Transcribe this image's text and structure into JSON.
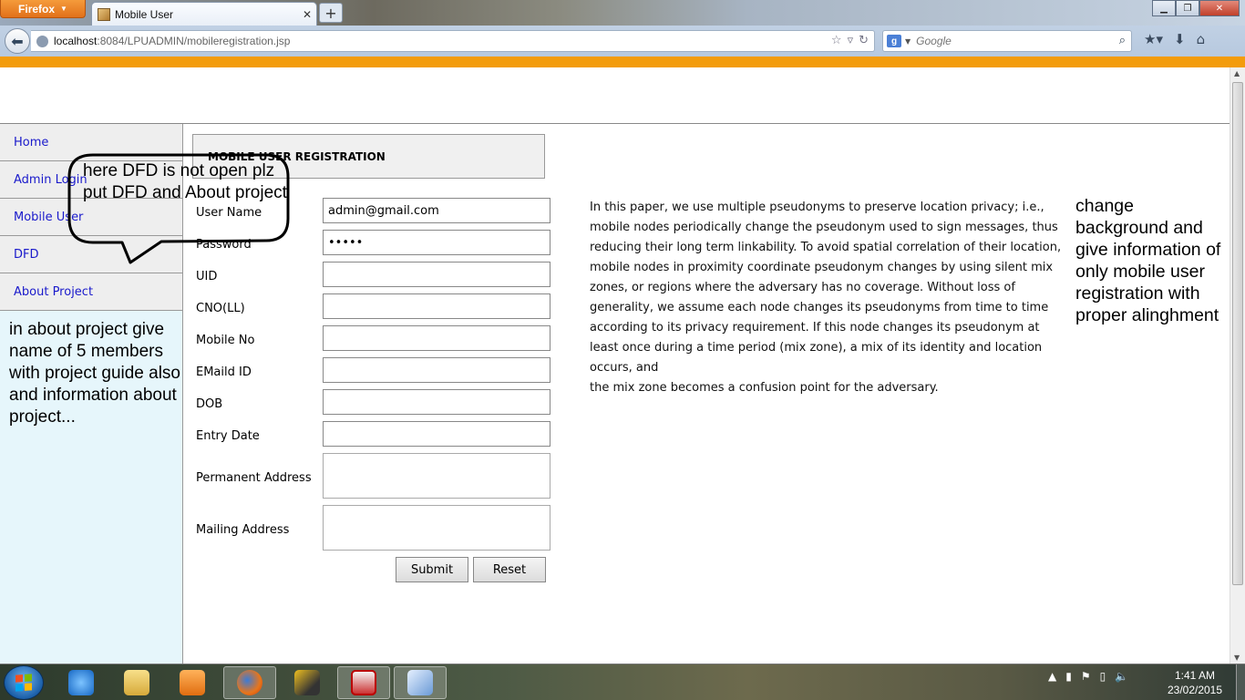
{
  "browser": {
    "menu_button": "Firefox",
    "tab_title": "Mobile User",
    "url_host": "localhost",
    "url_path": ":8084/LPUADMIN/mobileregistration.jsp",
    "search_placeholder": "Google",
    "search_engine_letter": "g"
  },
  "sidebar": {
    "items": [
      {
        "label": "Home"
      },
      {
        "label": "Admin Login"
      },
      {
        "label": "Mobile User"
      },
      {
        "label": "DFD"
      },
      {
        "label": "About Project"
      }
    ],
    "note": "in about project give name of 5 members with project guide also and information about project..."
  },
  "form": {
    "title": "MOBILE USER REGISTRATION",
    "fields": [
      {
        "label": "User Name",
        "value": "admin@gmail.com"
      },
      {
        "label": "Password",
        "value": "12345"
      },
      {
        "label": "UID",
        "value": ""
      },
      {
        "label": "CNO(LL)",
        "value": ""
      },
      {
        "label": "Mobile No",
        "value": ""
      },
      {
        "label": "EMaild ID",
        "value": ""
      },
      {
        "label": "DOB",
        "value": ""
      },
      {
        "label": "Entry Date",
        "value": ""
      },
      {
        "label": "Permanent Address",
        "value": ""
      },
      {
        "label": "Mailing Address",
        "value": ""
      }
    ],
    "submit_label": "Submit",
    "reset_label": "Reset"
  },
  "paragraph": {
    "lines": [
      "In this paper, we use multiple pseudonyms to preserve location privacy; i.e.,",
      "mobile nodes periodically change the pseudonym used to sign messages, thus",
      "reducing their long term linkability. To avoid spatial correlation of their location,",
      "mobile nodes in proximity coordinate pseudonym changes by using silent mix",
      "zones, or regions where the adversary has no coverage. Without loss of",
      "generality, we assume each node changes its pseudonyms from time to time",
      "according to its privacy requirement. If this node changes its pseudonym at",
      "least once during a time period (mix zone), a mix of its identity and location",
      "occurs, and",
      "the mix zone becomes a confusion point for the adversary."
    ]
  },
  "annotations": {
    "bubble": "here DFD is not open plz put DFD and About project",
    "right_note": "change background and give information of only mobile user registration with proper alinghment"
  },
  "taskbar": {
    "time": "1:41 AM",
    "date": "23/02/2015"
  },
  "colors": {
    "accent_bar": "#f39c0c",
    "sidebar_bg": "#e6f6fb",
    "nav_link": "#1a1acb"
  }
}
